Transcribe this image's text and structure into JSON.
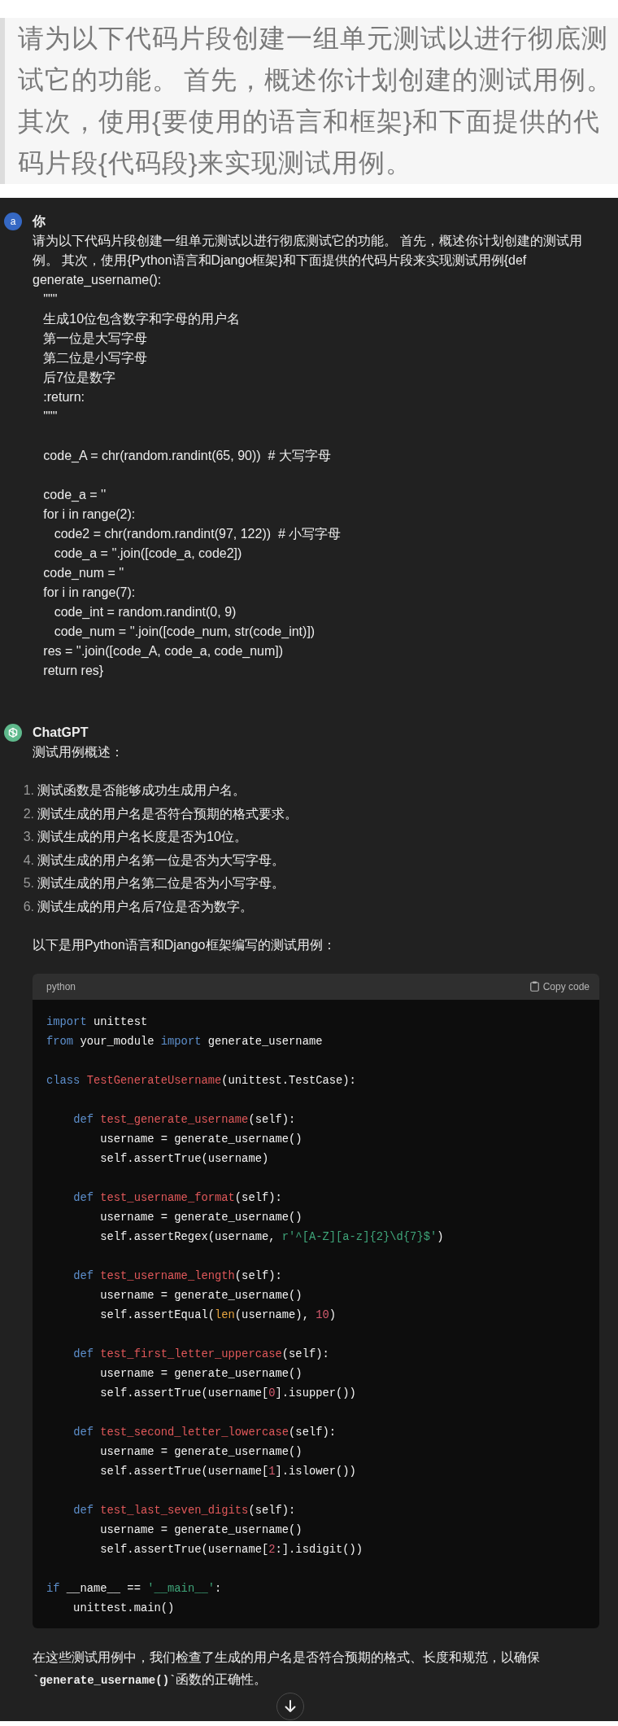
{
  "quote": {
    "text": "请为以下代码片段创建一组单元测试以进行彻底测试它的功能。 首先，概述你计划创建的测试用例。其次，使用{要使用的语言和框架}和下面提供的代码片段{代码段}来实现测试用例。"
  },
  "conversation": [
    {
      "kind": "user",
      "avatar": "a",
      "author": "你",
      "blocks": [
        [
          "请为以下代码片段创建一组单元测试以进行彻底测试它的功能。 首先，概述你计划创建的测试用例。 其次，使用{Python语言和Django框架}和下面提供的代码片段来实现测试用例{def generate_username():",
          "   \"\"\"",
          "   生成10位包含数字和字母的用户名",
          "   第一位是大写字母",
          "   第二位是小写字母",
          "   后7位是数字",
          "   :return:",
          "   \"\"\""
        ],
        [
          "   code_A = chr(random.randint(65, 90))  # 大写字母"
        ],
        [
          "   code_a = ''",
          "   for i in range(2):",
          "      code2 = chr(random.randint(97, 122))  # 小写字母",
          "      code_a = ''.join([code_a, code2])",
          "   code_num = ''",
          "   for i in range(7):",
          "      code_int = random.randint(0, 9)",
          "      code_num = ''.join([code_num, str(code_int)])",
          "   res = ''.join([code_A, code_a, code_num])",
          "   return res}"
        ]
      ]
    },
    {
      "kind": "assistant",
      "author": "ChatGPT",
      "intro": "测试用例概述：",
      "list": [
        {
          "number": "1.",
          "text": "测试函数是否能够成功生成用户名。"
        },
        {
          "number": "2.",
          "text": "测试生成的用户名是否符合预期的格式要求。"
        },
        {
          "number": "3.",
          "text": "测试生成的用户名长度是否为10位。"
        },
        {
          "number": "4.",
          "text": "测试生成的用户名第一位是否为大写字母。"
        },
        {
          "number": "5.",
          "text": "测试生成的用户名第二位是否为小写字母。"
        },
        {
          "number": "6.",
          "text": "测试生成的用户名后7位是否为数字。"
        }
      ],
      "lead": "以下是用Python语言和Django框架编写的测试用例：",
      "code_block": {
        "language": "python",
        "copy_label": "Copy code",
        "tokens": [
          {
            "kind": "keyword",
            "text": "import"
          },
          {
            "kind": "plain",
            "text": " unittest\n"
          },
          {
            "kind": "keyword",
            "text": "from"
          },
          {
            "kind": "plain",
            "text": " your_module "
          },
          {
            "kind": "keyword",
            "text": "import"
          },
          {
            "kind": "plain",
            "text": " generate_username\n\n"
          },
          {
            "kind": "keyword",
            "text": "class "
          },
          {
            "kind": "name",
            "text": "TestGenerateUsername"
          },
          {
            "kind": "plain",
            "text": "(unittest.TestCase):\n\n    "
          },
          {
            "kind": "keyword",
            "text": "def "
          },
          {
            "kind": "name",
            "text": "test_generate_username"
          },
          {
            "kind": "plain",
            "text": "(self):\n        username = generate_username()\n        self.assertTrue(username)\n\n    "
          },
          {
            "kind": "keyword",
            "text": "def "
          },
          {
            "kind": "name",
            "text": "test_username_format"
          },
          {
            "kind": "plain",
            "text": "(self):\n        username = generate_username()\n        self.assertRegex(username, "
          },
          {
            "kind": "string",
            "text": "r'^[A-Z][a-z]{2}\\d{7}$'"
          },
          {
            "kind": "plain",
            "text": ")\n\n    "
          },
          {
            "kind": "keyword",
            "text": "def "
          },
          {
            "kind": "name",
            "text": "test_username_length"
          },
          {
            "kind": "plain",
            "text": "(self):\n        username = generate_username()\n        self.assertEqual("
          },
          {
            "kind": "builtin",
            "text": "len"
          },
          {
            "kind": "plain",
            "text": "(username), "
          },
          {
            "kind": "number",
            "text": "10"
          },
          {
            "kind": "plain",
            "text": ")\n\n    "
          },
          {
            "kind": "keyword",
            "text": "def "
          },
          {
            "kind": "name",
            "text": "test_first_letter_uppercase"
          },
          {
            "kind": "plain",
            "text": "(self):\n        username = generate_username()\n        self.assertTrue(username["
          },
          {
            "kind": "number",
            "text": "0"
          },
          {
            "kind": "plain",
            "text": "].isupper())\n\n    "
          },
          {
            "kind": "keyword",
            "text": "def "
          },
          {
            "kind": "name",
            "text": "test_second_letter_lowercase"
          },
          {
            "kind": "plain",
            "text": "(self):\n        username = generate_username()\n        self.assertTrue(username["
          },
          {
            "kind": "number",
            "text": "1"
          },
          {
            "kind": "plain",
            "text": "].islower())\n\n    "
          },
          {
            "kind": "keyword",
            "text": "def "
          },
          {
            "kind": "name",
            "text": "test_last_seven_digits"
          },
          {
            "kind": "plain",
            "text": "(self):\n        username = generate_username()\n        self.assertTrue(username["
          },
          {
            "kind": "number",
            "text": "2"
          },
          {
            "kind": "plain",
            "text": ":].isdigit())\n\n"
          },
          {
            "kind": "keyword",
            "text": "if"
          },
          {
            "kind": "plain",
            "text": " __name__ == "
          },
          {
            "kind": "string",
            "text": "'__main__'"
          },
          {
            "kind": "plain",
            "text": ":\n    unittest.main()"
          }
        ]
      },
      "conclusion": "在这些测试用例中，我们检查了生成的用户名是否符合预期的格式、长度和规范，以确保**`generate_username()`**函数的正确性。"
    }
  ]
}
